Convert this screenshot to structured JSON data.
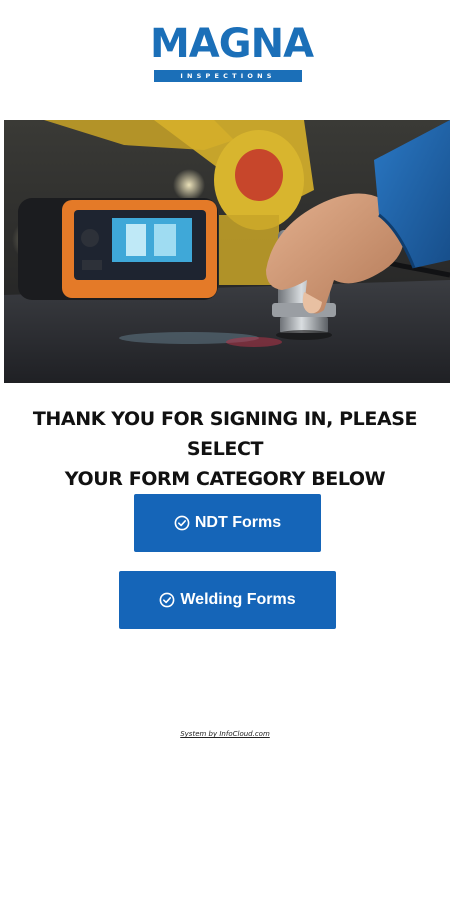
{
  "brand": {
    "name": "MAGNA",
    "subtitle": "INSPECTIONS",
    "color": "#1b6fb8"
  },
  "hero": {
    "icon": "ndt-inspection-photo"
  },
  "heading": {
    "line1": "THANK YOU FOR SIGNING IN, PLEASE SELECT",
    "line2": "YOUR FORM CATEGORY BELOW"
  },
  "buttons": {
    "ndt_label": "NDT Forms",
    "welding_label": "Welding Forms",
    "icon": "check-circle-icon",
    "color": "#1565b8"
  },
  "footer": {
    "text": "System by InfoCloud.com"
  }
}
